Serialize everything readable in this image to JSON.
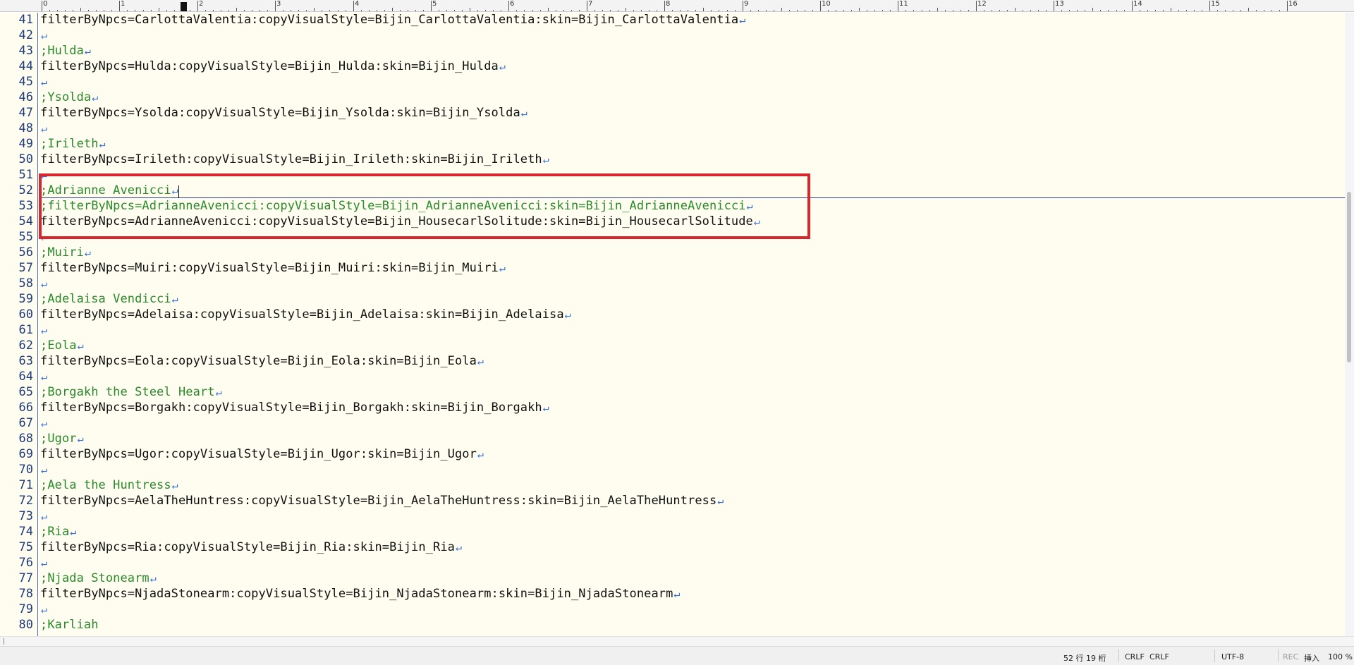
{
  "ruler": {
    "numbers": [
      "0",
      "1",
      "2",
      "3",
      "4",
      "5",
      "6",
      "7",
      "8",
      "9",
      "10",
      "11",
      "12",
      "13",
      "14",
      "15",
      "16"
    ]
  },
  "lines": [
    {
      "n": "41",
      "text": "filterByNpcs=CarlottaValentia:copyVisualStyle=Bijin_CarlottaValentia:skin=Bijin_CarlottaValentia",
      "comment": false
    },
    {
      "n": "42",
      "text": "",
      "comment": false
    },
    {
      "n": "43",
      "text": ";Hulda",
      "comment": true
    },
    {
      "n": "44",
      "text": "filterByNpcs=Hulda:copyVisualStyle=Bijin_Hulda:skin=Bijin_Hulda",
      "comment": false
    },
    {
      "n": "45",
      "text": "",
      "comment": false
    },
    {
      "n": "46",
      "text": ";Ysolda",
      "comment": true
    },
    {
      "n": "47",
      "text": "filterByNpcs=Ysolda:copyVisualStyle=Bijin_Ysolda:skin=Bijin_Ysolda",
      "comment": false
    },
    {
      "n": "48",
      "text": "",
      "comment": false
    },
    {
      "n": "49",
      "text": ";Irileth",
      "comment": true
    },
    {
      "n": "50",
      "text": "filterByNpcs=Irileth:copyVisualStyle=Bijin_Irileth:skin=Bijin_Irileth",
      "comment": false
    },
    {
      "n": "51",
      "text": "",
      "comment": false
    },
    {
      "n": "52",
      "text": ";Adrianne Avenicci",
      "comment": true
    },
    {
      "n": "53",
      "text": ";filterByNpcs=AdrianneAvenicci:copyVisualStyle=Bijin_AdrianneAvenicci:skin=Bijin_AdrianneAvenicci",
      "comment": true
    },
    {
      "n": "54",
      "text": "filterByNpcs=AdrianneAvenicci:copyVisualStyle=Bijin_HousecarlSolitude:skin=Bijin_HousecarlSolitude",
      "comment": false
    },
    {
      "n": "55",
      "text": "",
      "comment": false
    },
    {
      "n": "56",
      "text": ";Muiri",
      "comment": true
    },
    {
      "n": "57",
      "text": "filterByNpcs=Muiri:copyVisualStyle=Bijin_Muiri:skin=Bijin_Muiri",
      "comment": false
    },
    {
      "n": "58",
      "text": "",
      "comment": false
    },
    {
      "n": "59",
      "text": ";Adelaisa Vendicci",
      "comment": true
    },
    {
      "n": "60",
      "text": "filterByNpcs=Adelaisa:copyVisualStyle=Bijin_Adelaisa:skin=Bijin_Adelaisa",
      "comment": false
    },
    {
      "n": "61",
      "text": "",
      "comment": false
    },
    {
      "n": "62",
      "text": ";Eola",
      "comment": true
    },
    {
      "n": "63",
      "text": "filterByNpcs=Eola:copyVisualStyle=Bijin_Eola:skin=Bijin_Eola",
      "comment": false
    },
    {
      "n": "64",
      "text": "",
      "comment": false
    },
    {
      "n": "65",
      "text": ";Borgakh the Steel Heart",
      "comment": true
    },
    {
      "n": "66",
      "text": "filterByNpcs=Borgakh:copyVisualStyle=Bijin_Borgakh:skin=Bijin_Borgakh",
      "comment": false
    },
    {
      "n": "67",
      "text": "",
      "comment": false
    },
    {
      "n": "68",
      "text": ";Ugor",
      "comment": true
    },
    {
      "n": "69",
      "text": "filterByNpcs=Ugor:copyVisualStyle=Bijin_Ugor:skin=Bijin_Ugor",
      "comment": false
    },
    {
      "n": "70",
      "text": "",
      "comment": false
    },
    {
      "n": "71",
      "text": ";Aela the Huntress",
      "comment": true
    },
    {
      "n": "72",
      "text": "filterByNpcs=AelaTheHuntress:copyVisualStyle=Bijin_AelaTheHuntress:skin=Bijin_AelaTheHuntress",
      "comment": false
    },
    {
      "n": "73",
      "text": "",
      "comment": false
    },
    {
      "n": "74",
      "text": ";Ria",
      "comment": true
    },
    {
      "n": "75",
      "text": "filterByNpcs=Ria:copyVisualStyle=Bijin_Ria:skin=Bijin_Ria",
      "comment": false
    },
    {
      "n": "76",
      "text": "",
      "comment": false
    },
    {
      "n": "77",
      "text": ";Njada Stonearm",
      "comment": true
    },
    {
      "n": "78",
      "text": "filterByNpcs=NjadaStonearm:copyVisualStyle=Bijin_NjadaStonearm:skin=Bijin_NjadaStonearm",
      "comment": false
    },
    {
      "n": "79",
      "text": "",
      "comment": false
    },
    {
      "n": "80",
      "text": ";Karliah",
      "comment": true
    }
  ],
  "eol_glyph": "↵",
  "status": {
    "position": "52 行  19 桁",
    "newline_1": "CRLF",
    "newline_2": "CRLF",
    "encoding": "UTF-8",
    "rec": "REC",
    "insert_mode": "挿入",
    "zoom": "100 %"
  },
  "colors": {
    "background": "#fffdf0",
    "comment": "#2a8a2a",
    "line_number": "#1f3a7a",
    "eol_mark": "#3a6fd8",
    "highlight_box": "#d7262c"
  }
}
